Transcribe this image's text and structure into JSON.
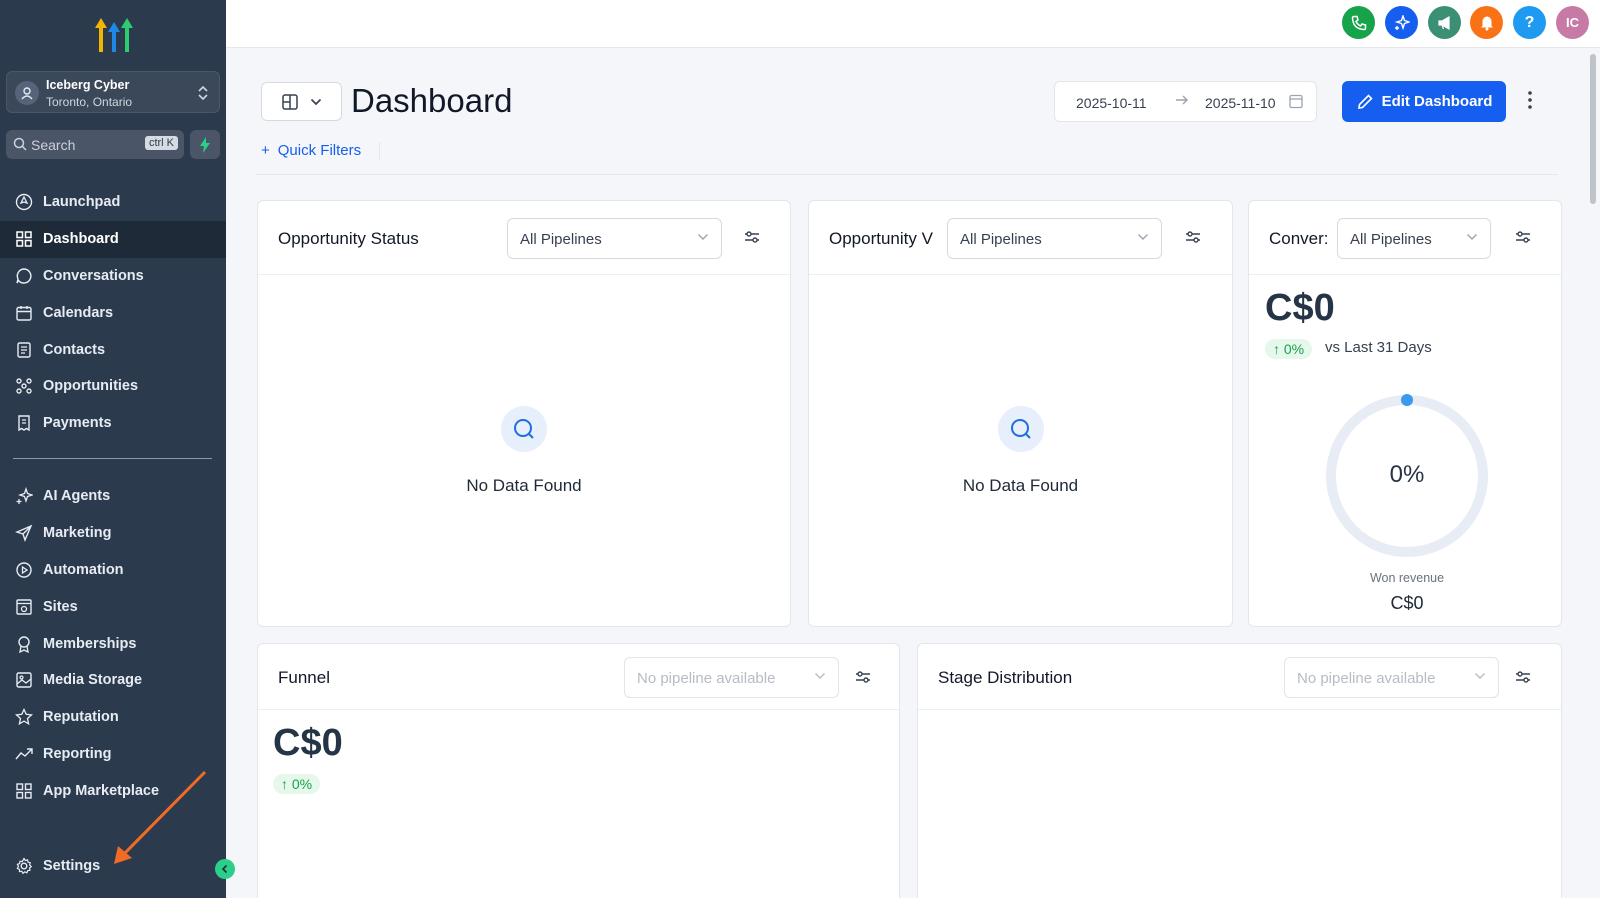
{
  "account": {
    "name": "Iceberg Cyber",
    "location": "Toronto, Ontario"
  },
  "search": {
    "placeholder": "Search",
    "shortcut": "ctrl K"
  },
  "sidebar": {
    "main_items": [
      {
        "label": "Launchpad",
        "icon": "rocket-icon"
      },
      {
        "label": "Dashboard",
        "icon": "grid-icon",
        "active": true
      },
      {
        "label": "Conversations",
        "icon": "chat-icon"
      },
      {
        "label": "Calendars",
        "icon": "calendar-icon"
      },
      {
        "label": "Contacts",
        "icon": "contacts-icon"
      },
      {
        "label": "Opportunities",
        "icon": "network-icon"
      },
      {
        "label": "Payments",
        "icon": "invoice-icon"
      }
    ],
    "secondary_items": [
      {
        "label": "AI Agents",
        "icon": "sparkle-icon"
      },
      {
        "label": "Marketing",
        "icon": "send-icon"
      },
      {
        "label": "Automation",
        "icon": "automation-icon"
      },
      {
        "label": "Sites",
        "icon": "sites-icon"
      },
      {
        "label": "Memberships",
        "icon": "badge-icon"
      },
      {
        "label": "Media Storage",
        "icon": "image-icon"
      },
      {
        "label": "Reputation",
        "icon": "star-icon"
      },
      {
        "label": "Reporting",
        "icon": "trend-icon"
      },
      {
        "label": "App Marketplace",
        "icon": "apps-icon"
      }
    ],
    "settings_label": "Settings"
  },
  "topbar": {
    "buttons": [
      {
        "name": "phone-icon",
        "color": "#16a34a"
      },
      {
        "name": "sparkle-icon",
        "color": "#155eef"
      },
      {
        "name": "megaphone-icon",
        "color": "#3a8f74"
      },
      {
        "name": "bell-icon",
        "color": "#f97316"
      },
      {
        "name": "help-icon",
        "color": "#1e9bf0",
        "text": "?"
      },
      {
        "name": "avatar",
        "color": "#c77aa6",
        "text": "IC"
      }
    ]
  },
  "header": {
    "title": "Dashboard",
    "date_from": "2025-10-11",
    "date_to": "2025-11-10",
    "edit_label": "Edit Dashboard",
    "quick_filters": "Quick Filters"
  },
  "cards": {
    "opp_status": {
      "title": "Opportunity Status",
      "select": "All Pipelines",
      "empty": "No Data Found"
    },
    "opp_value": {
      "title": "Opportunity V",
      "select": "All Pipelines",
      "empty": "No Data Found"
    },
    "conversion": {
      "title": "Conver:",
      "select": "All Pipelines",
      "value": "C$0",
      "change": "↑ 0%",
      "vs": "vs Last 31 Days",
      "rate": "0%",
      "won_label": "Won revenue",
      "won_value": "C$0"
    },
    "funnel": {
      "title": "Funnel",
      "select": "No pipeline available",
      "value": "C$0",
      "change": "↑ 0%"
    },
    "stage": {
      "title": "Stage Distribution",
      "select": "No pipeline available"
    }
  },
  "colors": {
    "sidebar": "#2c3a4d",
    "primary": "#155eef",
    "success": "#16a34a"
  }
}
